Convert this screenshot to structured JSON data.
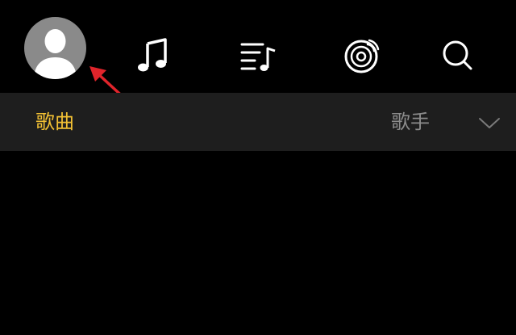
{
  "header": {
    "icons": {
      "avatar": "user-avatar-icon",
      "music": "music-note-icon",
      "playlist": "playlist-icon",
      "radio": "radio-disc-icon",
      "search": "search-icon"
    },
    "colors": {
      "icon": "#ffffff",
      "avatar_bg": "#8a8a8a",
      "avatar_figure": "#ffffff"
    }
  },
  "annotation": {
    "type": "arrow",
    "color": "#e0242b"
  },
  "tabs": {
    "items": [
      {
        "label": "歌曲",
        "active": true
      },
      {
        "label": "",
        "active": false
      },
      {
        "label": "",
        "active": false
      },
      {
        "label": "歌手",
        "active": false
      }
    ],
    "more_icon": "chevron-down-icon",
    "colors": {
      "active": "#f2c034",
      "inactive": "#8c8c8c",
      "bar_bg": "#1e1e1e"
    }
  }
}
